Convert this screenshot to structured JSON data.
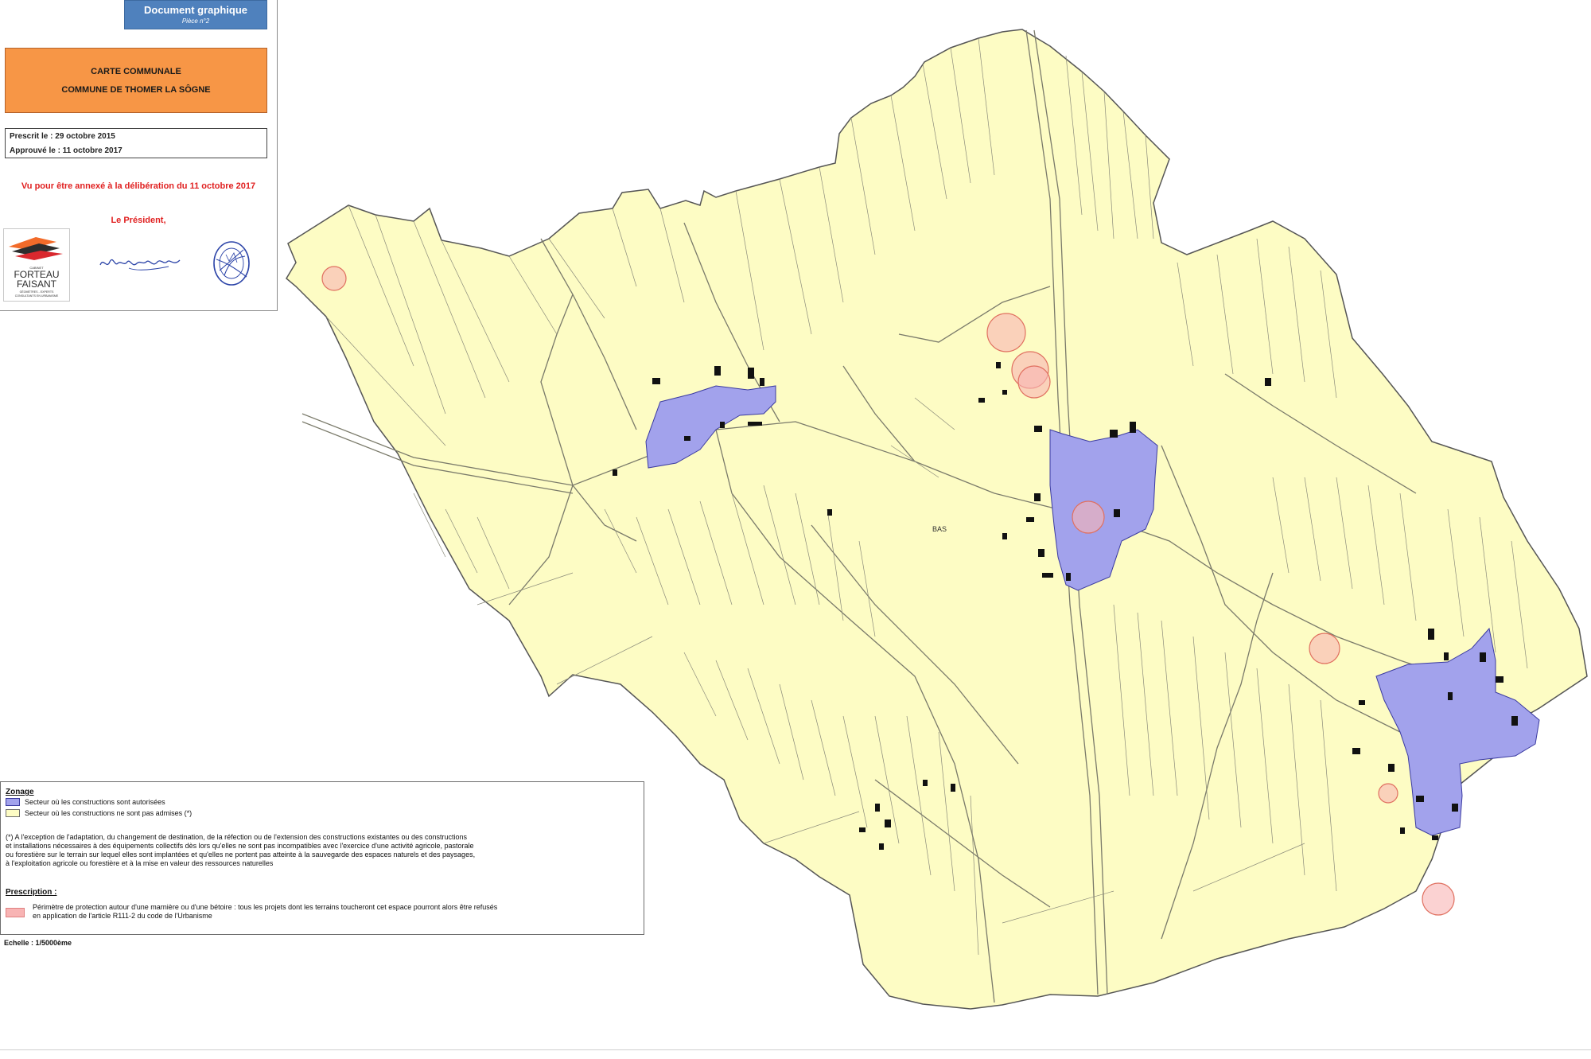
{
  "title_block": {
    "document_label": "Document graphique",
    "piece_label": "Pièce n°2",
    "map_type": "CARTE COMMUNALE",
    "commune": "COMMUNE DE THOMER LA SÔGNE",
    "prescribed": "Prescrit le  : 29 octobre 2015",
    "approved": "Approuvé le : 11 octobre 2017",
    "annex_note": "Vu pour être annexé à la délibération du 11 octobre 2017",
    "signatory": "Le Président,",
    "logo": {
      "word1": "FORTEAU",
      "word2": "FAISANT",
      "cabinet": "CABINET",
      "tagline1": "GÉOMÈTRES - EXPERTS",
      "tagline2": "CONSULTANTS EN URBANISME"
    },
    "signature_text": "Jean-Luc Boulegne"
  },
  "legend": {
    "zonage_title": "Zonage",
    "authorized": "Secteur où les constructions sont autorisées",
    "not_allowed": "Secteur où les constructions ne sont pas admises (*)",
    "note": "(*) A l'exception de l'adaptation, du changement de destination, de la réfection ou de l'extension des constructions existantes ou des constructions\net installations nécessaires à des équipements collectifs dès lors qu'elles ne sont pas incompatibles avec l'exercice d'une activité agricole, pastorale\nou forestière sur le terrain sur lequel elles sont implantées et qu'elles ne portent pas atteinte à la sauvegarde des espaces naturels et des paysages,\nà l'exploitation agricole ou forestière et à la mise en valeur des ressources naturelles",
    "prescription_title": "Prescription :",
    "prescription_text": "Périmètre de protection autour d'une marnière ou d'une bétoire : tous les projets dont les terrains toucheront cet espace pourront alors être refusés\nen application de l'article R111-2 du code de l'Urbanisme"
  },
  "scale": "Echelle : 1/5000ème",
  "colors": {
    "parcel_fill": "#fdfcc4",
    "parcel_stroke": "#5a5a4a",
    "authorized_fill": "#a2a2ec",
    "building_fill": "#111111",
    "protection_fill": "#f8b4b4",
    "protection_stroke": "#e07060",
    "orange_title": "#f79646",
    "blue_label": "#4f81bd",
    "red_text": "#e02020"
  },
  "map_labels": {
    "village_center": "BAS"
  }
}
